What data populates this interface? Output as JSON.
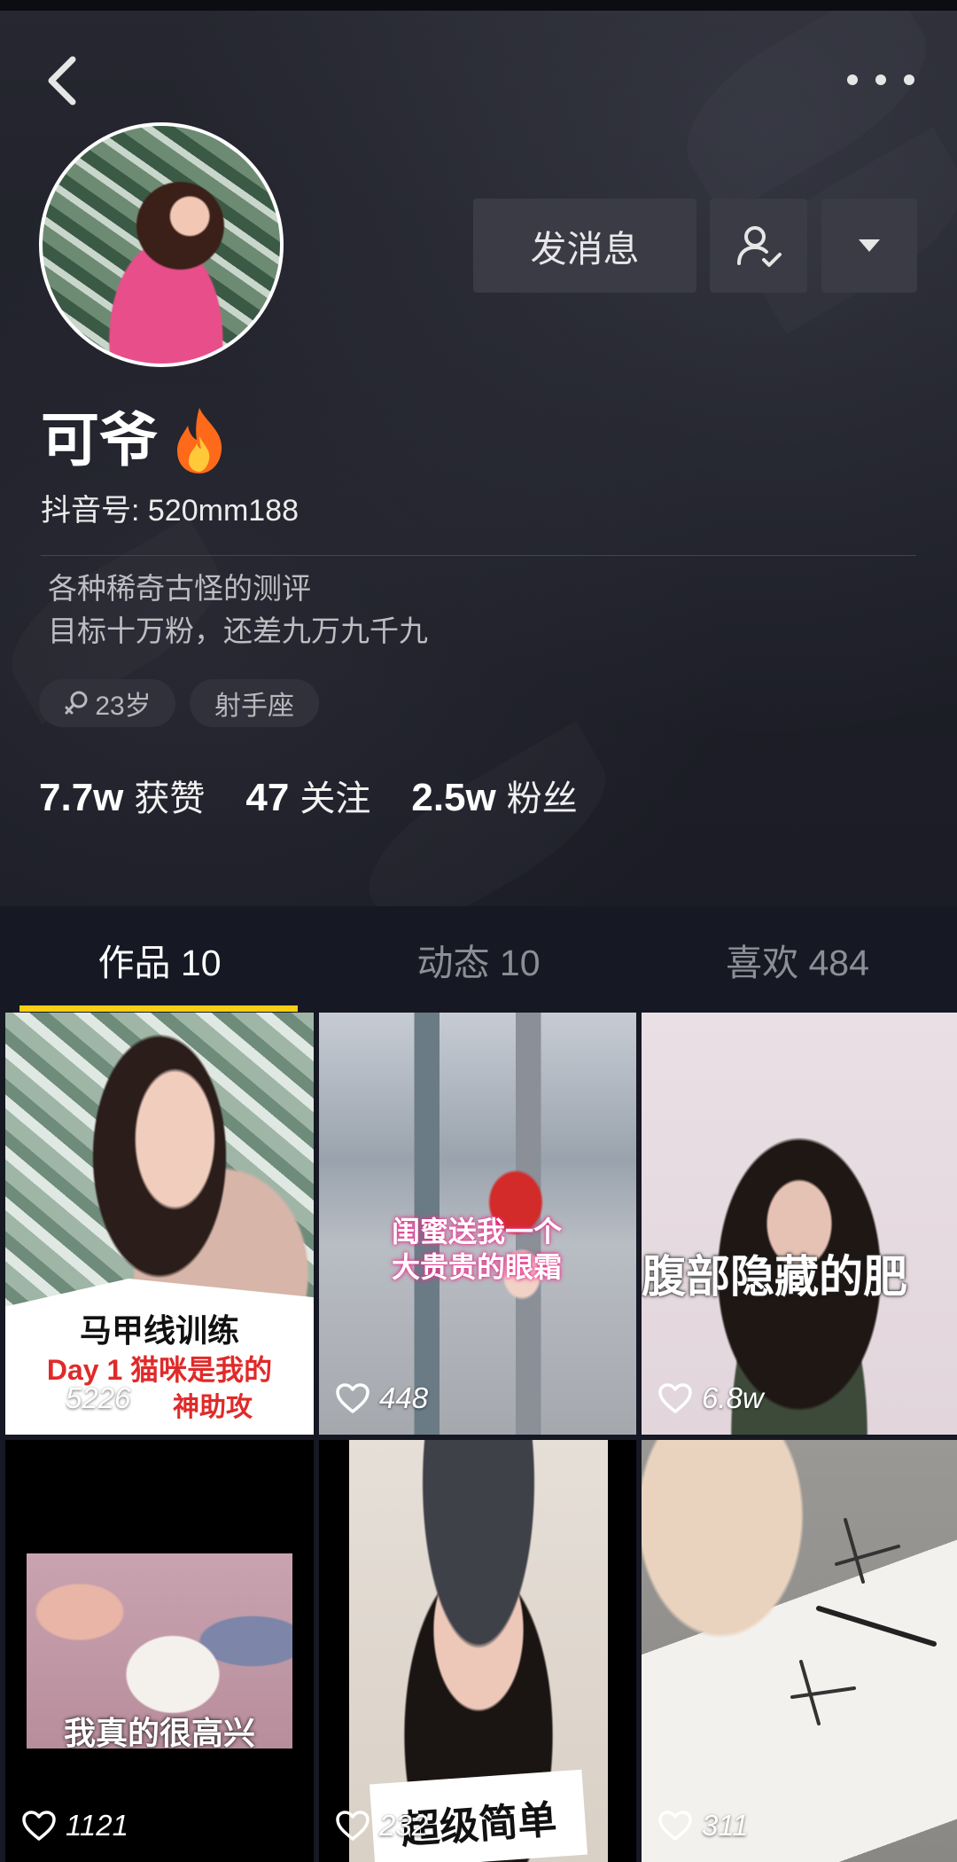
{
  "header": {
    "back_icon": "chevron-left-icon",
    "more_icon": "more-dots-icon"
  },
  "profile": {
    "avatar": "avatar-photo",
    "name": "可爷",
    "badge_icon": "fire-icon",
    "douyin_id": "抖音号: 520mm188",
    "bio_lines": [
      "各种稀奇古怪的测评",
      "目标十万粉，还差九万九千九"
    ],
    "tags": [
      "23岁",
      "射手座"
    ],
    "gender_icon": "female-icon"
  },
  "actions": {
    "message_label": "发消息",
    "follow_icon": "user-check-icon",
    "dropdown_icon": "triangle-down-icon"
  },
  "stats": [
    {
      "value": "7.7w",
      "label": "获赞"
    },
    {
      "value": "47",
      "label": "关注"
    },
    {
      "value": "2.5w",
      "label": "粉丝"
    }
  ],
  "tabs": [
    {
      "label": "作品 10",
      "active": true
    },
    {
      "label": "动态 10",
      "active": false
    },
    {
      "label": "喜欢 484",
      "active": false
    }
  ],
  "accent_color": "#face15",
  "videos": [
    {
      "likes": "5226",
      "caption_lines": [
        "马甲线训练",
        "Day 1 猫咪是我的",
        "神助攻"
      ]
    },
    {
      "likes": "448",
      "caption_lines": [
        "闺蜜送我一个",
        "大贵贵的眼霜"
      ]
    },
    {
      "likes": "6.8w",
      "caption_lines": [
        "腹部隐藏的肥"
      ]
    },
    {
      "likes": "1121",
      "caption_lines": [
        "我真的很高兴"
      ]
    },
    {
      "likes": "232",
      "caption_lines": [
        "超级简单"
      ]
    },
    {
      "likes": "311",
      "caption_lines": []
    }
  ]
}
